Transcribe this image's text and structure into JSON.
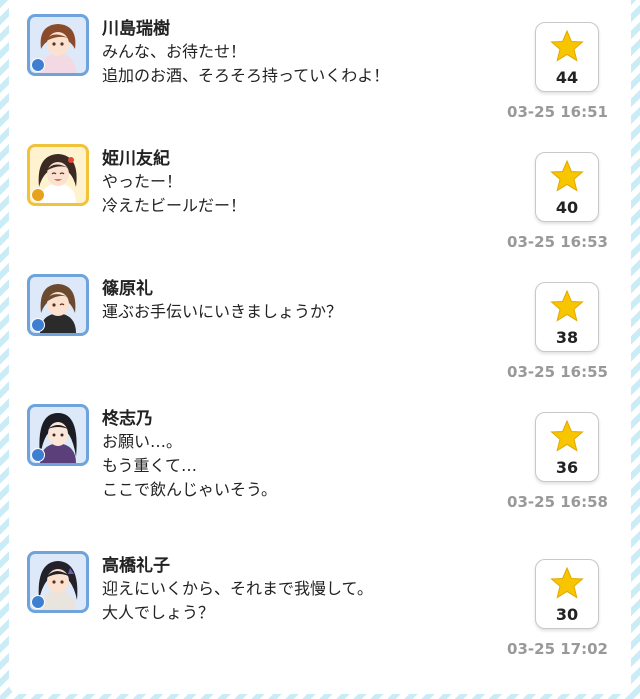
{
  "colors": {
    "stripe": "#c9ecf6",
    "frame_blue": "#6fa3dc",
    "frame_gold": "#f0c33a",
    "star": "#f7c600",
    "time": "#999999"
  },
  "icons": {
    "like": "star-icon",
    "rarity": "rarity-badge-icon"
  },
  "posts": [
    {
      "name": "川島瑞樹",
      "frame": "blue",
      "lines": [
        "みんな、お待たせ！",
        "追加のお酒、そろそろ持っていくわよ！"
      ],
      "likes": "44",
      "time": "03-25 16:51"
    },
    {
      "name": "姫川友紀",
      "frame": "gold",
      "lines": [
        "やったー！",
        "冷えたビールだー！"
      ],
      "likes": "40",
      "time": "03-25 16:53"
    },
    {
      "name": "篠原礼",
      "frame": "blue",
      "lines": [
        "運ぶお手伝いにいきましょうか？"
      ],
      "likes": "38",
      "time": "03-25 16:55"
    },
    {
      "name": "柊志乃",
      "frame": "blue",
      "lines": [
        "お願い…。",
        "もう重くて…",
        "ここで飲んじゃいそう。"
      ],
      "likes": "36",
      "time": "03-25 16:58"
    },
    {
      "name": "高橋礼子",
      "frame": "blue",
      "lines": [
        "迎えにいくから、それまで我慢して。",
        "大人でしょう？"
      ],
      "likes": "30",
      "time": "03-25 17:02"
    }
  ]
}
